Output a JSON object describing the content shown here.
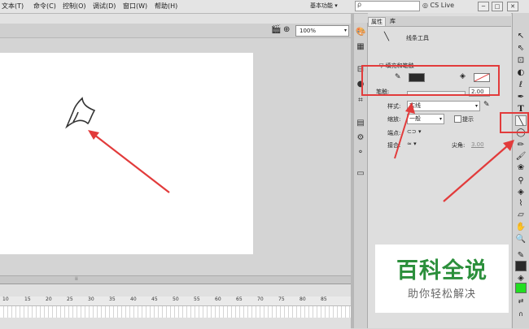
{
  "menubar": {
    "items": [
      "文本(T)",
      "命令(C)",
      "控制(O)",
      "调试(D)",
      "窗口(W)",
      "帮助(H)"
    ],
    "workspace": "基本功能 ▾",
    "search_placeholder": "ρ",
    "cs_live": "CS Live",
    "minimize": "─",
    "restore": "□",
    "close": "✕"
  },
  "stage": {
    "zoom": "100%",
    "zoom_arrow": "▾"
  },
  "timeline": {
    "ticks": [
      "10",
      "15",
      "20",
      "25",
      "30",
      "35",
      "40",
      "45",
      "50",
      "55",
      "60",
      "65",
      "70",
      "75",
      "80",
      "85"
    ]
  },
  "properties_panel": {
    "tabs": [
      "属性",
      "库"
    ],
    "tool_name": "线条工具",
    "section_title": "▽ 填充和笔触",
    "stroke_size_label": "笔触:",
    "stroke_size_value": "2.00",
    "style_label": "样式:",
    "style_value": "实线",
    "scale_label": "缩放:",
    "scale_value": "一般",
    "hint_label": "提示",
    "cap_label": "端点:",
    "join_label": "接合:",
    "miter_label": "尖角:",
    "miter_value": "3.00"
  },
  "icons": {
    "strip": [
      "paint-icon",
      "grid-icon",
      "align-icon",
      "color-icon",
      "transform-icon",
      "history-icon",
      "component-icon",
      "motion-icon",
      "code-icon"
    ],
    "tools": [
      "selection-arrow",
      "subselection-arrow",
      "free-transform",
      "3d-rotation",
      "lasso",
      "pen",
      "text",
      "line",
      "oval",
      "pencil",
      "brush",
      "deco",
      "bone",
      "paint-bucket",
      "eyedropper",
      "eraser",
      "hand",
      "zoom",
      "stroke-color",
      "fill-color",
      "swap-colors",
      "snap"
    ]
  },
  "colors": {
    "stroke": "#2a2a2a",
    "fill": "#ffffff",
    "fill_tool": "#22dd22",
    "annotation": "#e23b3b"
  },
  "watermark": {
    "title": "百科全说",
    "subtitle": "助你轻松解决"
  }
}
